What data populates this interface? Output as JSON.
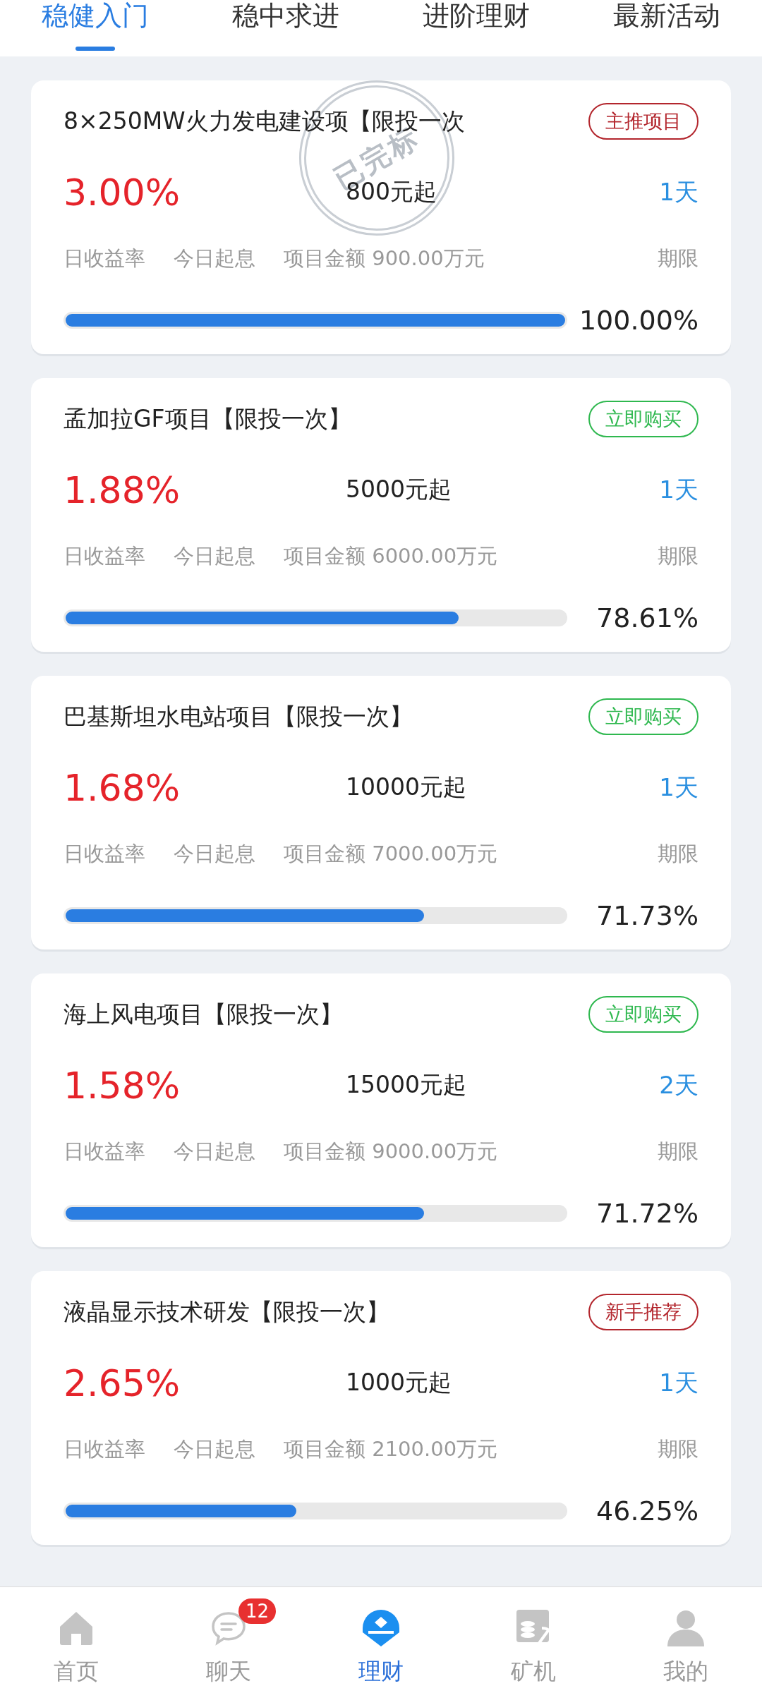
{
  "tabs": [
    {
      "label": "稳健入门",
      "selected": true
    },
    {
      "label": "稳中求进",
      "selected": false
    },
    {
      "label": "进阶理财",
      "selected": false
    },
    {
      "label": "最新活动",
      "selected": false
    }
  ],
  "products": [
    {
      "title": "8×250MW火力发电建设项【限投一次",
      "tag": {
        "text": "主推项目",
        "color": "#b3262d"
      },
      "stamp": "已完标",
      "rate": "3.00%",
      "minimum": "800元起",
      "term": "1天",
      "rate_label": "日收益率",
      "interest_label": "今日起息",
      "amount": "项目金额 900.00万元",
      "term_label": "期限",
      "level": 1.0,
      "percent": "100.00%"
    },
    {
      "title": "孟加拉GF项目【限投一次】",
      "tag": {
        "text": "立即购买",
        "color": "#2fb84f"
      },
      "rate": "1.88%",
      "minimum": "5000元起",
      "term": "1天",
      "rate_label": "日收益率",
      "interest_label": "今日起息",
      "amount": "项目金额 6000.00万元",
      "term_label": "期限",
      "level": 0.7861,
      "percent": "78.61%"
    },
    {
      "title": "巴基斯坦水电站项目【限投一次】",
      "tag": {
        "text": "立即购买",
        "color": "#2fb84f"
      },
      "rate": "1.68%",
      "minimum": "10000元起",
      "term": "1天",
      "rate_label": "日收益率",
      "interest_label": "今日起息",
      "amount": "项目金额 7000.00万元",
      "term_label": "期限",
      "level": 0.7173,
      "percent": "71.73%"
    },
    {
      "title": "海上风电项目【限投一次】",
      "tag": {
        "text": "立即购买",
        "color": "#2fb84f"
      },
      "rate": "1.58%",
      "minimum": "15000元起",
      "term": "2天",
      "rate_label": "日收益率",
      "interest_label": "今日起息",
      "amount": "项目金额 9000.00万元",
      "term_label": "期限",
      "level": 0.7172,
      "percent": "71.72%"
    },
    {
      "title": "液晶显示技术研发【限投一次】",
      "tag": {
        "text": "新手推荐",
        "color": "#b3262d"
      },
      "rate": "2.65%",
      "minimum": "1000元起",
      "term": "1天",
      "rate_label": "日收益率",
      "interest_label": "今日起息",
      "amount": "项目金额 2100.00万元",
      "term_label": "期限",
      "level": 0.4625,
      "percent": "46.25%"
    }
  ],
  "nav": [
    {
      "label": "首页",
      "selected": false
    },
    {
      "label": "聊天",
      "badge": "12",
      "selected": false
    },
    {
      "label": "理财",
      "selected": true
    },
    {
      "label": "矿机",
      "selected": false
    },
    {
      "label": "我的",
      "selected": false
    }
  ]
}
